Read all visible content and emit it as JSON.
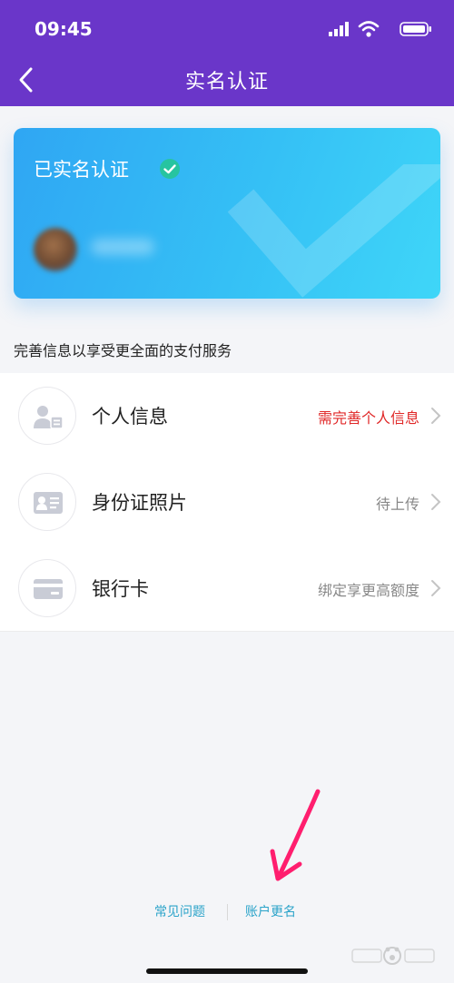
{
  "status_bar": {
    "time": "09:45"
  },
  "nav": {
    "title": "实名认证",
    "back_icon": "chevron-left-icon"
  },
  "card": {
    "status_text": "已实名认证",
    "badge_icon": "check-circle-icon"
  },
  "section": {
    "hint": "完善信息以享受更全面的支付服务"
  },
  "items": [
    {
      "title": "个人信息",
      "value": "需完善个人信息",
      "icon": "person-card-icon",
      "value_color": "#e02727"
    },
    {
      "title": "身份证照片",
      "value": "待上传",
      "icon": "id-card-icon",
      "value_color": "#888888"
    },
    {
      "title": "银行卡",
      "value": "绑定享更高额度",
      "icon": "bank-card-icon",
      "value_color": "#888888"
    }
  ],
  "footer": {
    "faq_label": "常见问题",
    "rename_label": "账户更名"
  },
  "colors": {
    "header": "#6a36c9",
    "card_gradient_start": "#2fa6f3",
    "card_gradient_end": "#3fd6f8",
    "link": "#2aa3c9",
    "annotation_arrow": "#ff1e6e"
  }
}
